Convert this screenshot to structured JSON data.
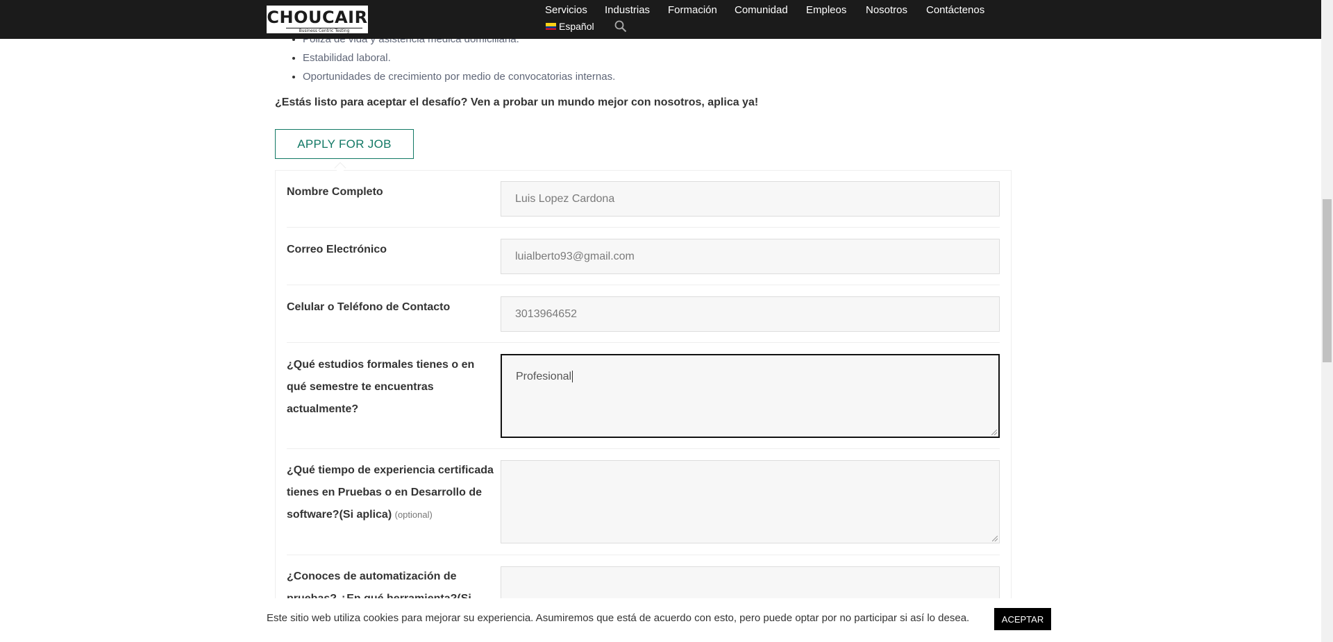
{
  "header": {
    "logo_text": "CHOUCAIR",
    "logo_tagline": "Business Centric Testing",
    "nav": [
      "Servicios",
      "Industrias",
      "Formación",
      "Comunidad",
      "Empleos",
      "Nosotros",
      "Contáctenos"
    ],
    "language": "Español",
    "search_icon": "search-icon"
  },
  "benefits": [
    "Póliza de vida y asistencia médica domiciliaria.",
    "Estabilidad laboral.",
    "Oportunidades de crecimiento por medio de convocatorias internas."
  ],
  "cta_text": "¿Estás listo para aceptar el desafío? Ven a probar un mundo mejor con nosotros, aplica ya!",
  "apply_button": "APPLY FOR JOB",
  "form": {
    "fields": [
      {
        "label": "Nombre Completo",
        "value": "Luis Lopez Cardona",
        "optional": ""
      },
      {
        "label": "Correo Electrónico",
        "value": "luialberto93@gmail.com",
        "optional": ""
      },
      {
        "label": "Celular o Teléfono de Contacto",
        "value": "3013964652",
        "optional": ""
      },
      {
        "label": "¿Qué estudios formales tienes o en qué semestre te encuentras actualmente?",
        "value": "Profesional",
        "optional": ""
      },
      {
        "label": "¿Qué tiempo de experiencia certificada tienes en Pruebas o en Desarrollo de software?(Si aplica)",
        "value": "",
        "optional": "(optional)"
      },
      {
        "label": "¿Conoces de automatización de pruebas? ¿En qué herramienta?(Si aplica)",
        "value": "",
        "optional": ""
      }
    ]
  },
  "cookie": {
    "text": "Este sitio web utiliza cookies para mejorar su experiencia. Asumiremos que está de acuerdo con esto, pero puede optar por no participar si así lo desea.",
    "button": "ACEPTAR"
  },
  "colors": {
    "header_bg": "#1b1b1b",
    "accent": "#117864",
    "field_bg": "#f7f7f7"
  }
}
